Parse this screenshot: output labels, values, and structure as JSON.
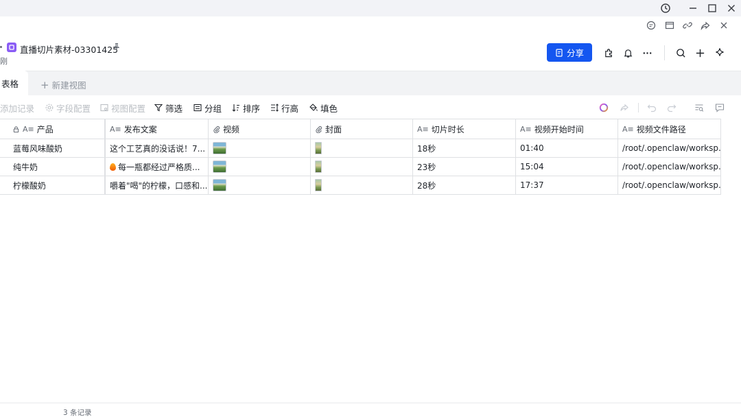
{
  "doc": {
    "title": "直播切片素材-03301425",
    "subtitle": "刚"
  },
  "header": {
    "share_label": "分享"
  },
  "tabs": {
    "active": "表格",
    "new_view": "新建视图"
  },
  "toolbar": {
    "add_record": "添加记录",
    "field_config": "字段配置",
    "view_config": "视图配置",
    "filter": "筛选",
    "group": "分组",
    "sort": "排序",
    "row_height": "行高",
    "fill_color": "填色"
  },
  "columns": [
    "产品",
    "发布文案",
    "视频",
    "封面",
    "切片时长",
    "视频开始时间",
    "视频文件路径"
  ],
  "rows": [
    {
      "product": "蓝莓风味酸奶",
      "copy": "这个工艺真的没话说！7...",
      "duration": "18秒",
      "start": "01:40",
      "path": "/root/.openclaw/worksp..."
    },
    {
      "product": "纯牛奶",
      "copy": "每一瓶都经过严格质...",
      "duration": "23秒",
      "start": "15:04",
      "path": "/root/.openclaw/worksp..."
    },
    {
      "product": "柠檬酸奶",
      "copy": "嚼着\"喝\"的柠檬，口感和...",
      "duration": "28秒",
      "start": "17:37",
      "path": "/root/.openclaw/worksp..."
    }
  ],
  "footer": {
    "count": "3 条记录"
  },
  "colors": {
    "accent": "#1456f0",
    "doc_icon": "#8a5cf5"
  }
}
